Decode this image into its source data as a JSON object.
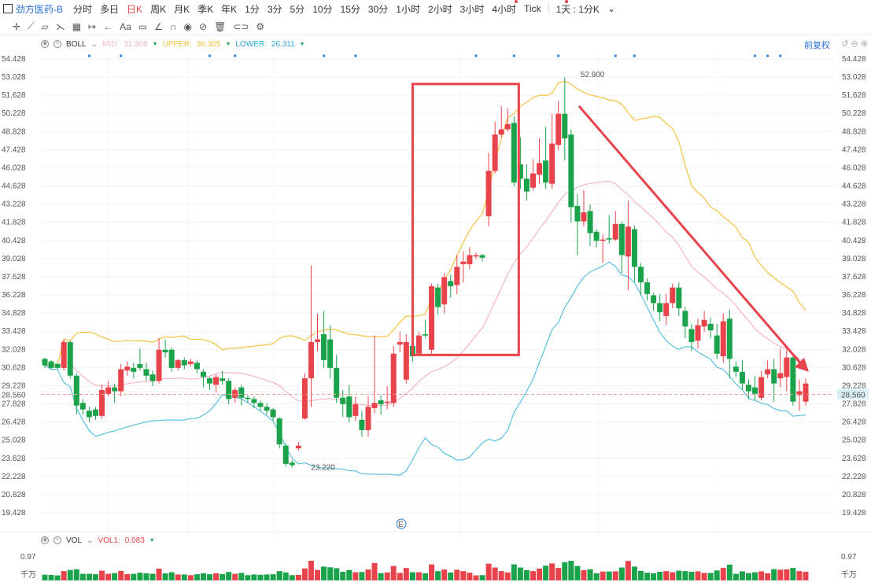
{
  "header": {
    "stock_name": "劲方医药-B",
    "periods": [
      "分时",
      "多日",
      "日K",
      "周K",
      "月K",
      "季K",
      "年K",
      "1分",
      "3分",
      "5分",
      "10分",
      "15分",
      "30分",
      "1小时",
      "2小时",
      "3小时",
      "4小时",
      "Tick"
    ],
    "active_period": "日K",
    "time_setting": "1天 : 1分K"
  },
  "indicator": {
    "name": "BOLL",
    "mid_label": "MID:",
    "mid_value": "31.308",
    "upper_label": "UPPER:",
    "upper_value": "36.305",
    "lower_label": "LOWER:",
    "lower_value": "26.311",
    "adjust_label": "前复权"
  },
  "volume_panel": {
    "name": "VOL",
    "vol1_label": "VOL1:",
    "vol1_value": "0.083",
    "top_label": "0.97",
    "unit_label": "千万"
  },
  "colors": {
    "up": "#e8424a",
    "down": "#1aa34a",
    "mid": "#f4b6c2",
    "upper": "#f5c242",
    "lower": "#5bc0e0",
    "arrow": "#e8424a",
    "price_line": "#f4a59a"
  },
  "annotations": {
    "high_label": "52.900",
    "low_label": "23.220",
    "current_price": "28.560"
  },
  "chart_data": {
    "type": "candlestick",
    "y_ticks": [
      "54.428",
      "53.028",
      "51.628",
      "50.228",
      "48.828",
      "47.428",
      "46.028",
      "44.628",
      "43.228",
      "41.828",
      "40.428",
      "39.028",
      "37.628",
      "36.228",
      "34.828",
      "33.428",
      "32.028",
      "30.628",
      "29.228",
      "27.828",
      "26.428",
      "25.028",
      "23.628",
      "22.228",
      "20.828",
      "19.428"
    ],
    "ylim": [
      19.428,
      54.428
    ],
    "candles": [
      [
        31.3,
        30.8,
        31.4,
        30.6
      ],
      [
        31.1,
        30.6,
        31.2,
        30.5
      ],
      [
        30.9,
        30.6,
        31.0,
        30.5
      ],
      [
        30.6,
        32.6,
        32.8,
        30.4
      ],
      [
        32.6,
        30.0,
        32.7,
        29.8
      ],
      [
        30.0,
        27.7,
        30.2,
        27.0
      ],
      [
        27.9,
        27.4,
        28.2,
        27.0
      ],
      [
        27.3,
        26.8,
        27.6,
        26.4
      ],
      [
        27.4,
        26.9,
        27.6,
        26.6
      ],
      [
        26.9,
        28.9,
        29.3,
        26.7
      ],
      [
        28.6,
        29.1,
        29.6,
        28.4
      ],
      [
        29.1,
        28.8,
        29.4,
        27.9
      ],
      [
        28.8,
        30.5,
        30.9,
        28.4
      ],
      [
        30.4,
        30.7,
        31.1,
        30.0
      ],
      [
        30.6,
        30.3,
        31.0,
        29.8
      ],
      [
        30.9,
        30.6,
        32.1,
        30.4
      ],
      [
        30.5,
        30.0,
        31.0,
        29.6
      ],
      [
        30.1,
        29.6,
        30.4,
        29.2
      ],
      [
        29.6,
        32.0,
        32.9,
        29.4
      ],
      [
        32.0,
        31.8,
        32.8,
        31.4
      ],
      [
        32.0,
        30.6,
        32.2,
        30.3
      ],
      [
        30.6,
        31.2,
        31.3,
        30.4
      ],
      [
        31.2,
        30.8,
        31.4,
        30.5
      ],
      [
        30.9,
        31.1,
        31.3,
        30.7
      ],
      [
        31.0,
        30.5,
        31.2,
        30.2
      ],
      [
        30.3,
        29.9,
        30.5,
        29.1
      ],
      [
        29.8,
        29.4,
        29.9,
        28.9
      ],
      [
        29.3,
        29.9,
        30.1,
        28.7
      ],
      [
        29.8,
        29.6,
        30.4,
        29.3
      ],
      [
        29.6,
        28.2,
        29.8,
        27.8
      ],
      [
        28.3,
        28.9,
        29.1,
        27.9
      ],
      [
        29.1,
        28.3,
        29.3,
        27.7
      ],
      [
        28.3,
        28.2,
        28.5,
        27.9
      ],
      [
        28.2,
        27.9,
        28.4,
        27.5
      ],
      [
        27.9,
        27.6,
        28.1,
        27.3
      ],
      [
        27.6,
        27.3,
        27.9,
        27.0
      ],
      [
        27.4,
        26.8,
        27.5,
        26.5
      ],
      [
        26.7,
        24.7,
        26.8,
        24.4
      ],
      [
        24.6,
        23.2,
        24.8,
        23.0
      ],
      [
        23.3,
        23.1,
        23.5,
        22.9
      ],
      [
        24.4,
        24.6,
        24.9,
        24.2
      ],
      [
        26.7,
        29.8,
        30.2,
        26.6
      ],
      [
        29.8,
        32.6,
        38.5,
        27.6
      ],
      [
        32.6,
        32.8,
        34.8,
        31.9
      ],
      [
        33.2,
        31.2,
        35.0,
        30.6
      ],
      [
        32.8,
        30.6,
        33.9,
        29.8
      ],
      [
        30.6,
        28.3,
        31.6,
        27.9
      ],
      [
        28.3,
        27.8,
        28.9,
        26.8
      ],
      [
        28.4,
        26.8,
        29.3,
        26.4
      ],
      [
        26.9,
        27.8,
        28.4,
        26.5
      ],
      [
        26.6,
        25.8,
        27.3,
        25.3
      ],
      [
        25.8,
        27.6,
        28.4,
        25.3
      ],
      [
        27.5,
        27.9,
        33.1,
        27.1
      ],
      [
        28.1,
        27.8,
        28.5,
        27.0
      ],
      [
        27.9,
        28.0,
        29.2,
        27.4
      ],
      [
        27.9,
        31.7,
        32.3,
        27.6
      ],
      [
        32.4,
        32.6,
        33.4,
        31.8
      ],
      [
        29.7,
        32.6,
        33.2,
        29.4
      ],
      [
        32.3,
        31.5,
        33.0,
        31.1
      ],
      [
        31.7,
        33.1,
        33.4,
        31.5
      ],
      [
        33.2,
        33.1,
        34.3,
        32.9
      ],
      [
        32.0,
        36.9,
        37.1,
        31.7
      ],
      [
        36.8,
        35.3,
        37.1,
        34.7
      ],
      [
        35.5,
        37.6,
        37.9,
        34.8
      ],
      [
        37.3,
        36.9,
        37.8,
        36.0
      ],
      [
        37.0,
        38.4,
        39.3,
        36.3
      ],
      [
        38.6,
        38.8,
        39.6,
        37.2
      ],
      [
        38.6,
        39.3,
        39.9,
        38.2
      ],
      [
        39.2,
        39.3,
        39.5,
        39.0
      ],
      [
        39.3,
        39.1,
        39.4,
        38.8
      ],
      [
        42.3,
        45.8,
        47.2,
        41.5
      ],
      [
        45.8,
        48.6,
        49.6,
        45.6
      ],
      [
        48.6,
        49.0,
        50.8,
        48.4
      ],
      [
        49.0,
        49.4,
        50.6,
        48.8
      ],
      [
        49.5,
        44.9,
        50.0,
        44.6
      ],
      [
        46.3,
        45.2,
        48.4,
        44.4
      ],
      [
        45.2,
        44.2,
        46.3,
        43.5
      ],
      [
        44.5,
        45.6,
        46.7,
        44.3
      ],
      [
        45.5,
        46.4,
        48.3,
        44.8
      ],
      [
        46.6,
        44.9,
        49.2,
        44.4
      ],
      [
        44.8,
        47.9,
        50.2,
        44.4
      ],
      [
        47.8,
        50.2,
        51.2,
        47.4
      ],
      [
        50.2,
        48.3,
        53.0,
        46.6
      ],
      [
        48.6,
        43.0,
        49.0,
        41.8
      ],
      [
        43.1,
        41.9,
        44.0,
        39.3
      ],
      [
        41.9,
        42.6,
        44.3,
        41.5
      ],
      [
        42.7,
        41.0,
        43.2,
        40.0
      ],
      [
        41.1,
        40.4,
        41.3,
        39.9
      ],
      [
        40.4,
        40.5,
        40.9,
        38.7
      ],
      [
        40.6,
        40.5,
        42.4,
        40.2
      ],
      [
        40.5,
        41.7,
        42.7,
        40.4
      ],
      [
        41.7,
        39.3,
        41.9,
        37.9
      ],
      [
        39.2,
        41.5,
        43.5,
        36.6
      ],
      [
        41.3,
        38.4,
        41.6,
        37.2
      ],
      [
        38.4,
        37.2,
        38.7,
        36.2
      ],
      [
        37.2,
        36.3,
        37.5,
        35.8
      ],
      [
        36.2,
        35.6,
        36.4,
        35.0
      ],
      [
        35.6,
        34.9,
        36.3,
        34.2
      ],
      [
        34.6,
        35.6,
        36.3,
        33.9
      ],
      [
        35.6,
        36.8,
        37.1,
        35.2
      ],
      [
        36.8,
        35.2,
        37.2,
        34.6
      ],
      [
        35.0,
        33.8,
        35.3,
        32.9
      ],
      [
        33.6,
        32.6,
        34.0,
        31.9
      ],
      [
        32.7,
        33.9,
        34.4,
        32.1
      ],
      [
        33.8,
        34.3,
        35.0,
        33.4
      ],
      [
        34.0,
        33.5,
        34.5,
        32.9
      ],
      [
        33.1,
        31.7,
        34.0,
        31.3
      ],
      [
        31.5,
        34.2,
        34.8,
        31.0
      ],
      [
        34.4,
        31.3,
        35.1,
        29.8
      ],
      [
        30.7,
        30.3,
        31.1,
        29.9
      ],
      [
        30.3,
        29.4,
        31.2,
        28.9
      ],
      [
        29.3,
        28.8,
        29.7,
        28.2
      ],
      [
        29.1,
        28.6,
        30.0,
        28.1
      ],
      [
        28.3,
        29.9,
        30.4,
        28.1
      ],
      [
        30.1,
        30.5,
        31.2,
        29.8
      ],
      [
        30.5,
        29.4,
        31.3,
        28.0
      ],
      [
        29.8,
        30.2,
        32.1,
        29.1
      ],
      [
        29.9,
        31.4,
        32.0,
        28.8
      ],
      [
        31.4,
        28.0,
        31.5,
        27.7
      ],
      [
        28.5,
        28.8,
        29.7,
        27.3
      ],
      [
        28.0,
        29.4,
        29.8,
        27.7
      ]
    ]
  }
}
